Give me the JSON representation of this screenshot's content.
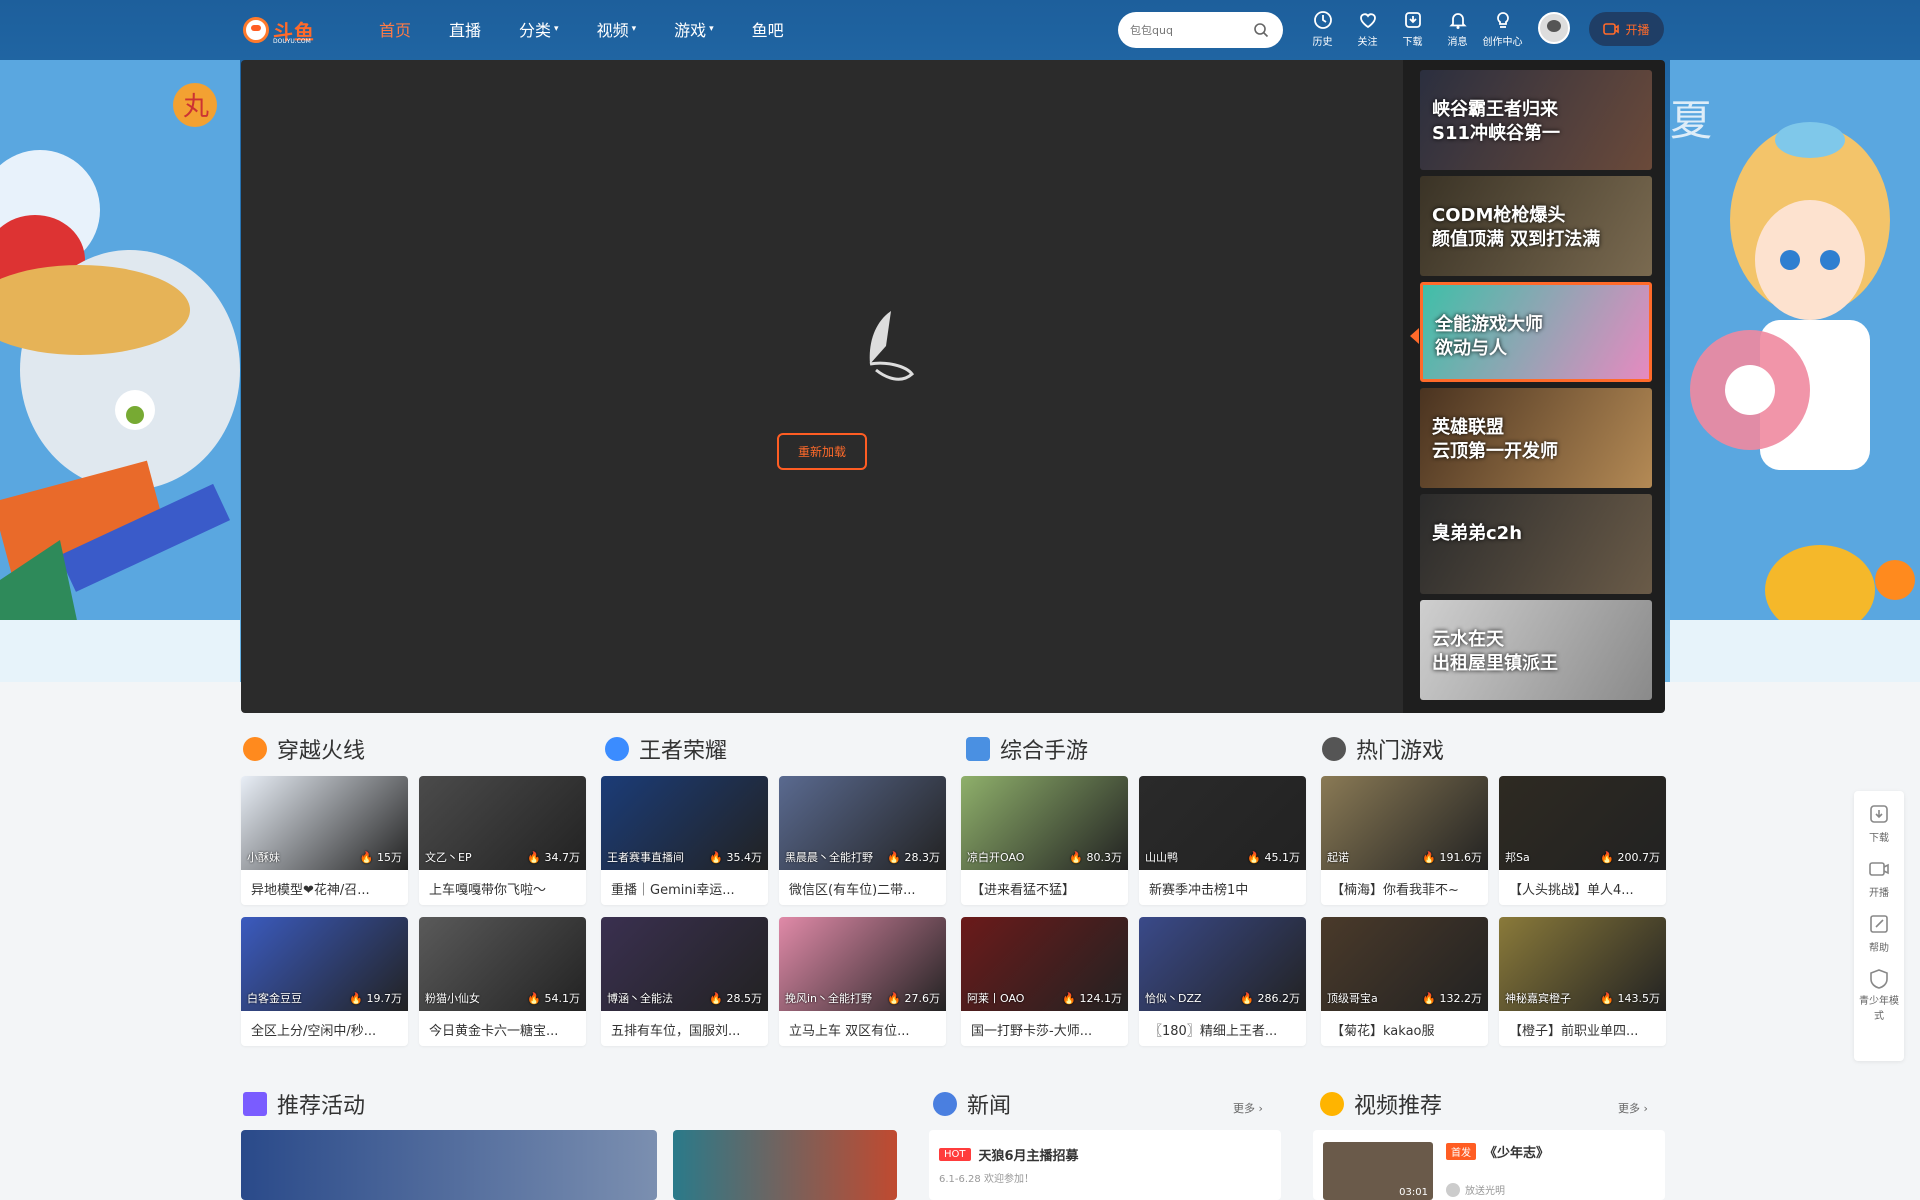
{
  "header": {
    "logo": "斗鱼",
    "logo_sub": "DOUYU.COM",
    "nav": [
      {
        "label": "首页",
        "active": true
      },
      {
        "label": "直播"
      },
      {
        "label": "分类",
        "caret": true
      },
      {
        "label": "视频",
        "caret": true
      },
      {
        "label": "游戏",
        "caret": true
      },
      {
        "label": "鱼吧"
      }
    ],
    "search_placeholder": "包包quq",
    "icons": [
      {
        "name": "history-icon",
        "label": "历史"
      },
      {
        "name": "follow-icon",
        "label": "关注"
      },
      {
        "name": "download-icon",
        "label": "下载"
      },
      {
        "name": "message-icon",
        "label": "消息"
      },
      {
        "name": "creator-icon",
        "label": "创作中心"
      }
    ],
    "live_btn": "开播"
  },
  "player": {
    "reload": "重新加载"
  },
  "recommend": [
    {
      "text": "峡谷霸王者归来\nS11冲峡谷第一",
      "c1": "#2b2f3f",
      "c2": "#6b4a3a"
    },
    {
      "text": "CODM枪枪爆头\n颜值顶满 双到打法满",
      "c1": "#3a3326",
      "c2": "#7a6a50"
    },
    {
      "text": "全能游戏大师\n欲动与人",
      "c1": "#3fbfa8",
      "c2": "#e68ac0"
    },
    {
      "text": "英雄联盟\n云顶第一开发师",
      "c1": "#4a3320",
      "c2": "#b48a55"
    },
    {
      "text": "臭弟弟c2h",
      "c1": "#2b2b2b",
      "c2": "#6a5b48"
    },
    {
      "text": "云水在天\n出租屋里镇派王",
      "c1": "#cfcfcf",
      "c2": "#8a8a8a"
    }
  ],
  "sections": [
    {
      "title": "穿越火线",
      "icon_color": "#ff8a1e"
    },
    {
      "title": "王者荣耀",
      "icon_color": "#3b8cff"
    },
    {
      "title": "综合手游",
      "icon_color": "#4a90e2"
    },
    {
      "title": "热门游戏",
      "icon_color": "#555"
    }
  ],
  "cards": [
    {
      "name": "小酥妹",
      "hot": "15万",
      "title": "异地模型❤花神/召...",
      "c": "#e8eef6"
    },
    {
      "name": "文乙丶EP",
      "hot": "34.7万",
      "title": "上车嘎嘎带你飞啦～",
      "c": "#4b4b4b"
    },
    {
      "name": "王者赛事直播间",
      "hot": "35.4万",
      "title": "重播｜Gemini幸运...",
      "c": "#1b3c78"
    },
    {
      "name": "黑晨晨丶全能打野",
      "hot": "28.3万",
      "title": "微信区(有车位)二带...",
      "c": "#5a6a90"
    },
    {
      "name": "凉白开OAO",
      "hot": "80.3万",
      "title": "【进来看猛不猛】",
      "c": "#8fb06b"
    },
    {
      "name": "山山鸭",
      "hot": "45.1万",
      "title": "新赛季冲击榜1中",
      "c": "#2a2a2a"
    },
    {
      "name": "起诺",
      "hot": "191.6万",
      "title": "【楠海】你看我菲不~",
      "c": "#8a7a55"
    },
    {
      "name": "邦Sa",
      "hot": "200.7万",
      "title": "【人头挑战】单人4...",
      "c": "#2e2a22"
    },
    {
      "name": "白客金豆豆",
      "hot": "19.7万",
      "title": "全区上分/空闲中/秒...",
      "c": "#3b5bbf"
    },
    {
      "name": "粉猫小仙女",
      "hot": "54.1万",
      "title": "今日黄金卡六一糖宝...",
      "c": "#5a5a5a"
    },
    {
      "name": "博涵丶全能法",
      "hot": "28.5万",
      "title": "五排有车位，国服刘...",
      "c": "#3a3050"
    },
    {
      "name": "挽风in丶全能打野",
      "hot": "27.6万",
      "title": "立马上车 双区有位...",
      "c": "#e08aa8"
    },
    {
      "name": "阿莱丨OAO",
      "hot": "124.1万",
      "title": "国一打野卡莎-大师...",
      "c": "#6b1a1a"
    },
    {
      "name": "恰似丶DZZ",
      "hot": "286.2万",
      "title": "〖180〗精细上王者...",
      "c": "#3a4a8a"
    },
    {
      "name": "顶级哥宝a",
      "hot": "132.2万",
      "title": "【菊花】kakao服",
      "c": "#4a3a2a"
    },
    {
      "name": "神秘嘉宾橙子",
      "hot": "143.5万",
      "title": "【橙子】前职业单四...",
      "c": "#8a7a3a"
    }
  ],
  "activity": {
    "title": "推荐活动"
  },
  "news": {
    "title": "新闻",
    "more": "更多",
    "items": [
      {
        "badge": "HOT",
        "title": "天狼6月主播招募",
        "sub": "6.1-6.28 欢迎参加！"
      }
    ]
  },
  "video": {
    "title": "视频推荐",
    "more": "更多",
    "items": [
      {
        "badge": "首发",
        "title": "《少年志》",
        "duration": "03:01",
        "author": "放送光明"
      }
    ]
  },
  "side_tools": [
    {
      "name": "download",
      "label": "下载"
    },
    {
      "name": "live",
      "label": "开播"
    },
    {
      "name": "help",
      "label": "帮助"
    },
    {
      "name": "teen",
      "label": "青少年模式"
    }
  ]
}
